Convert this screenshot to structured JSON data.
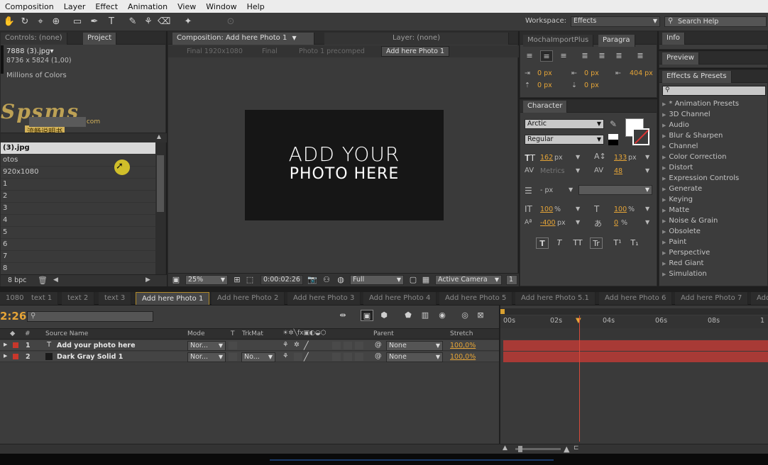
{
  "menu": [
    "Composition",
    "Layer",
    "Effect",
    "Animation",
    "View",
    "Window",
    "Help"
  ],
  "workspace": {
    "label": "Workspace:",
    "value": "Effects",
    "search_placeholder": "Search Help"
  },
  "left_panel": {
    "tabs": [
      "Controls: (none)",
      "Project"
    ],
    "file_name": "7888 (3).jpg▾",
    "file_dims": "8736 x 5824 (1,00)",
    "file_colors": "Millions of Colors",
    "watermark": "Spsms",
    "watermark_sub": "流畅说明书",
    "watermark_com": ".com",
    "rows": [
      "(3).jpg",
      "otos",
      "920x1080",
      "1",
      "2",
      "3",
      "4",
      "5",
      "6",
      "7",
      "8"
    ],
    "bpc": "8 bpc"
  },
  "comp_panel": {
    "tab": "Composition: Add here Photo 1",
    "layer_tab": "Layer: (none)",
    "crumbs": [
      "Final 1920x1080",
      "Final",
      "Photo 1 precomped",
      "Add here Photo 1"
    ],
    "preview_line1": "ADD YOUR",
    "preview_line2": "PHOTO HERE",
    "zoom": "25%",
    "time": "0:00:02:26",
    "resolution": "Full",
    "camera": "Active Camera",
    "views": "1"
  },
  "paragraph": {
    "tabs": [
      "MochaImportPlus",
      "Paragra"
    ],
    "indent_left": "0 px",
    "indent_first": "0 px",
    "indent_right": "404 px",
    "space_before": "0 px",
    "space_after": "0 px"
  },
  "character": {
    "tab": "Character",
    "font": "Arctic",
    "style": "Regular",
    "size": "162",
    "size_unit": "px",
    "leading": "133",
    "leading_unit": "px",
    "kerning": "Metrics",
    "tracking": "48",
    "stroke_width": "- px",
    "vscale": "100",
    "hscale": "100",
    "pct": "%",
    "baseline": "-400",
    "baseline_unit": "px",
    "tsume": "0",
    "styles": [
      "T",
      "T",
      "TT",
      "Tr",
      "T¹",
      "T₁"
    ]
  },
  "right_panel": {
    "info": "Info",
    "preview": "Preview",
    "effects_tab": "Effects & Presets",
    "effects": [
      "* Animation Presets",
      "3D Channel",
      "Audio",
      "Blur & Sharpen",
      "Channel",
      "Color Correction",
      "Distort",
      "Expression Controls",
      "Generate",
      "Keying",
      "Matte",
      "Noise & Grain",
      "Obsolete",
      "Paint",
      "Perspective",
      "Red Giant",
      "Simulation"
    ]
  },
  "timeline": {
    "tabs": [
      "1080",
      "text 1",
      "text 2",
      "text 3",
      "Add here Photo 1",
      "Add here Photo 2",
      "Add here Photo 3",
      "Add here Photo 4",
      "Add here Photo 5",
      "Add here  Photo 5.1",
      "Add here Photo 6",
      "Add here Photo 7",
      "Add"
    ],
    "timecode": "2:26",
    "columns": {
      "num": "#",
      "source": "Source Name",
      "mode": "Mode",
      "t": "T",
      "trkmat": "TrkMat",
      "parent": "Parent",
      "stretch": "Stretch"
    },
    "ruler": [
      "00s",
      "02s",
      "04s",
      "06s",
      "08s"
    ],
    "layers": [
      {
        "num": "1",
        "name": "Add your photo here",
        "mode": "Nor...",
        "trkmat": "",
        "parent": "None",
        "stretch": "100,0%",
        "color": "#c8372b"
      },
      {
        "num": "2",
        "name": "Dark Gray Solid 1",
        "mode": "Nor...",
        "trkmat": "No...",
        "parent": "None",
        "stretch": "100,0%",
        "color": "#c8372b"
      }
    ]
  },
  "colors": {
    "accent": "#e6a537",
    "bar": "#a83a36",
    "playhead": "#d84a3a"
  }
}
